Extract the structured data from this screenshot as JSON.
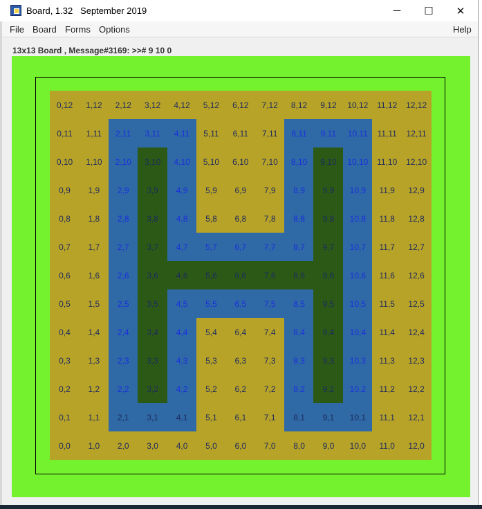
{
  "window": {
    "title": "Board, 1.32   September 2019"
  },
  "window_controls": {
    "minimize": "─",
    "maximize": "☐",
    "close": "✕"
  },
  "menu": {
    "items": [
      "File",
      "Board",
      "Forms",
      "Options"
    ],
    "help": "Help"
  },
  "status": {
    "text": "13x13 Board , Message#3169: >># 9 10 0"
  },
  "board": {
    "cols": 13,
    "rows": 13,
    "colors": {
      "background": "#74f22e",
      "base": "#b8a329",
      "blue": "#2f6aa6",
      "green": "#2c5a16",
      "text_dark": "#1d2a5c",
      "text_blue": "#1a2fdc"
    },
    "blue_cells": [
      "2,11",
      "3,11",
      "4,11",
      "8,11",
      "9,11",
      "10,11",
      "2,10",
      "4,10",
      "8,10",
      "10,10",
      "2,9",
      "4,9",
      "8,9",
      "10,9",
      "2,8",
      "4,8",
      "8,8",
      "10,8",
      "2,7",
      "4,7",
      "5,7",
      "6,7",
      "7,7",
      "8,7",
      "10,7",
      "2,6",
      "10,6",
      "2,5",
      "4,5",
      "5,5",
      "6,5",
      "7,5",
      "8,5",
      "10,5",
      "2,4",
      "4,4",
      "8,4",
      "10,4",
      "2,3",
      "4,3",
      "8,3",
      "10,3",
      "2,2",
      "4,2",
      "8,2",
      "10,2",
      "2,1",
      "3,1",
      "4,1",
      "8,1",
      "9,1",
      "10,1"
    ],
    "green_cells": [
      "3,10",
      "9,10",
      "3,9",
      "9,9",
      "3,8",
      "9,8",
      "3,7",
      "9,7",
      "3,6",
      "4,6",
      "5,6",
      "6,6",
      "7,6",
      "8,6",
      "9,6",
      "3,5",
      "9,5",
      "3,4",
      "9,4",
      "3,3",
      "9,3",
      "3,2",
      "9,2"
    ],
    "blue_text_cells": [
      "2,11",
      "3,11",
      "4,11",
      "8,11",
      "9,11",
      "10,11",
      "2,10",
      "4,10",
      "8,10",
      "10,10",
      "2,9",
      "4,9",
      "8,9",
      "10,9",
      "2,8",
      "4,8",
      "8,8",
      "10,8",
      "2,7",
      "4,7",
      "5,7",
      "6,7",
      "7,7",
      "8,7",
      "10,7",
      "2,6",
      "10,6",
      "2,5",
      "4,5",
      "5,5",
      "6,5",
      "7,5",
      "8,5",
      "10,5",
      "2,4",
      "4,4",
      "8,4",
      "10,4",
      "2,3",
      "4,3",
      "8,3",
      "10,3",
      "2,2",
      "4,2",
      "8,2",
      "10,2"
    ]
  }
}
